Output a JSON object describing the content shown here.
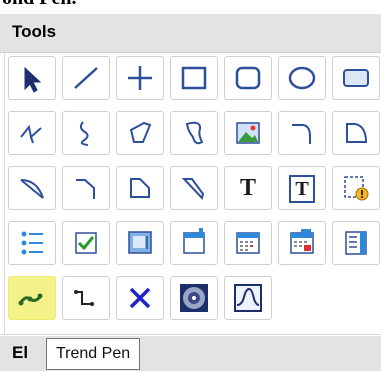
{
  "top_fragment": "ond Pen.",
  "panel": {
    "title": "Tools"
  },
  "tools": [
    {
      "id": "select",
      "icon": "arrow-pointer-icon"
    },
    {
      "id": "line",
      "icon": "diagonal-line-icon"
    },
    {
      "id": "cross",
      "icon": "plus-cross-icon"
    },
    {
      "id": "rectangle",
      "icon": "rectangle-icon"
    },
    {
      "id": "rounded-rectangle",
      "icon": "rounded-rectangle-icon"
    },
    {
      "id": "ellipse",
      "icon": "ellipse-icon"
    },
    {
      "id": "button-shape",
      "icon": "button-shape-icon"
    },
    {
      "id": "polyline",
      "icon": "zigzag-polyline-icon"
    },
    {
      "id": "freehand",
      "icon": "freehand-curve-icon"
    },
    {
      "id": "polygon",
      "icon": "polygon-icon"
    },
    {
      "id": "closed-curve",
      "icon": "closed-curve-icon"
    },
    {
      "id": "image",
      "icon": "image-picture-icon"
    },
    {
      "id": "arc",
      "icon": "arc-icon"
    },
    {
      "id": "pie",
      "icon": "pie-segment-icon"
    },
    {
      "id": "arc-2",
      "icon": "arc-chord-icon"
    },
    {
      "id": "arc-3",
      "icon": "arc-elbow-icon"
    },
    {
      "id": "pie-2",
      "icon": "pie-open-icon"
    },
    {
      "id": "chord",
      "icon": "chord-icon"
    },
    {
      "id": "text",
      "icon": "text-icon",
      "glyph": "T"
    },
    {
      "id": "text-box",
      "icon": "text-box-icon",
      "glyph": "T"
    },
    {
      "id": "tag",
      "icon": "tag-info-icon"
    },
    {
      "id": "list",
      "icon": "list-icon"
    },
    {
      "id": "checkbox",
      "icon": "checkbox-icon"
    },
    {
      "id": "panel-image",
      "icon": "panel-image-icon"
    },
    {
      "id": "window",
      "icon": "window-icon"
    },
    {
      "id": "calendar",
      "icon": "calendar-icon"
    },
    {
      "id": "date-picker",
      "icon": "date-picker-icon"
    },
    {
      "id": "spinner",
      "icon": "spinner-list-icon"
    },
    {
      "id": "trend-pen",
      "icon": "trend-pen-icon",
      "selected": true
    },
    {
      "id": "step-line",
      "icon": "step-line-icon"
    },
    {
      "id": "delete",
      "icon": "x-delete-icon"
    },
    {
      "id": "media",
      "icon": "media-disc-icon"
    },
    {
      "id": "trend-wave",
      "icon": "trend-wave-icon"
    }
  ],
  "section2": {
    "title": "El"
  },
  "tooltip": {
    "text": "Trend Pen"
  },
  "colors": {
    "highlight": "#f3f38a",
    "header_bg": "#e3e3e3",
    "icon_blue": "#2e4f9a"
  }
}
